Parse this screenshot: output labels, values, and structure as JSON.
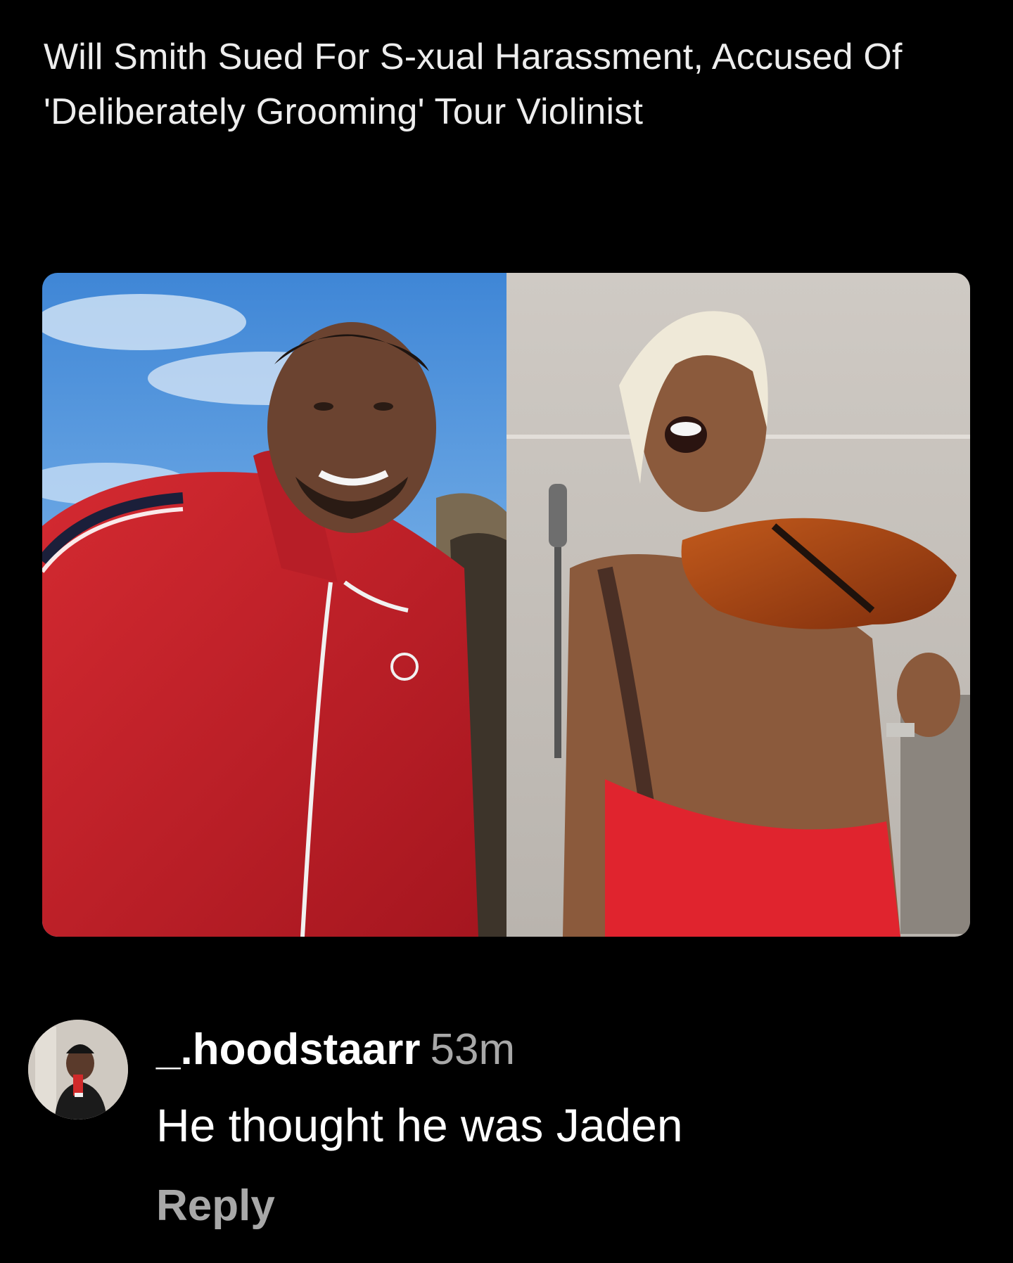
{
  "post": {
    "headline": "Will Smith Sued For S-xual Harassment, Accused Of 'Deliberately Grooming' Tour Violinist"
  },
  "comment": {
    "username": "_.hoodstaarr",
    "timestamp": "53m",
    "text": "He thought he was Jaden",
    "reply_label": "Reply"
  },
  "colors": {
    "background": "#000000",
    "text_primary": "#ffffff",
    "text_secondary": "#a8a8a8",
    "jacket_red": "#c8202a",
    "sky_blue": "#4a8fd8"
  }
}
